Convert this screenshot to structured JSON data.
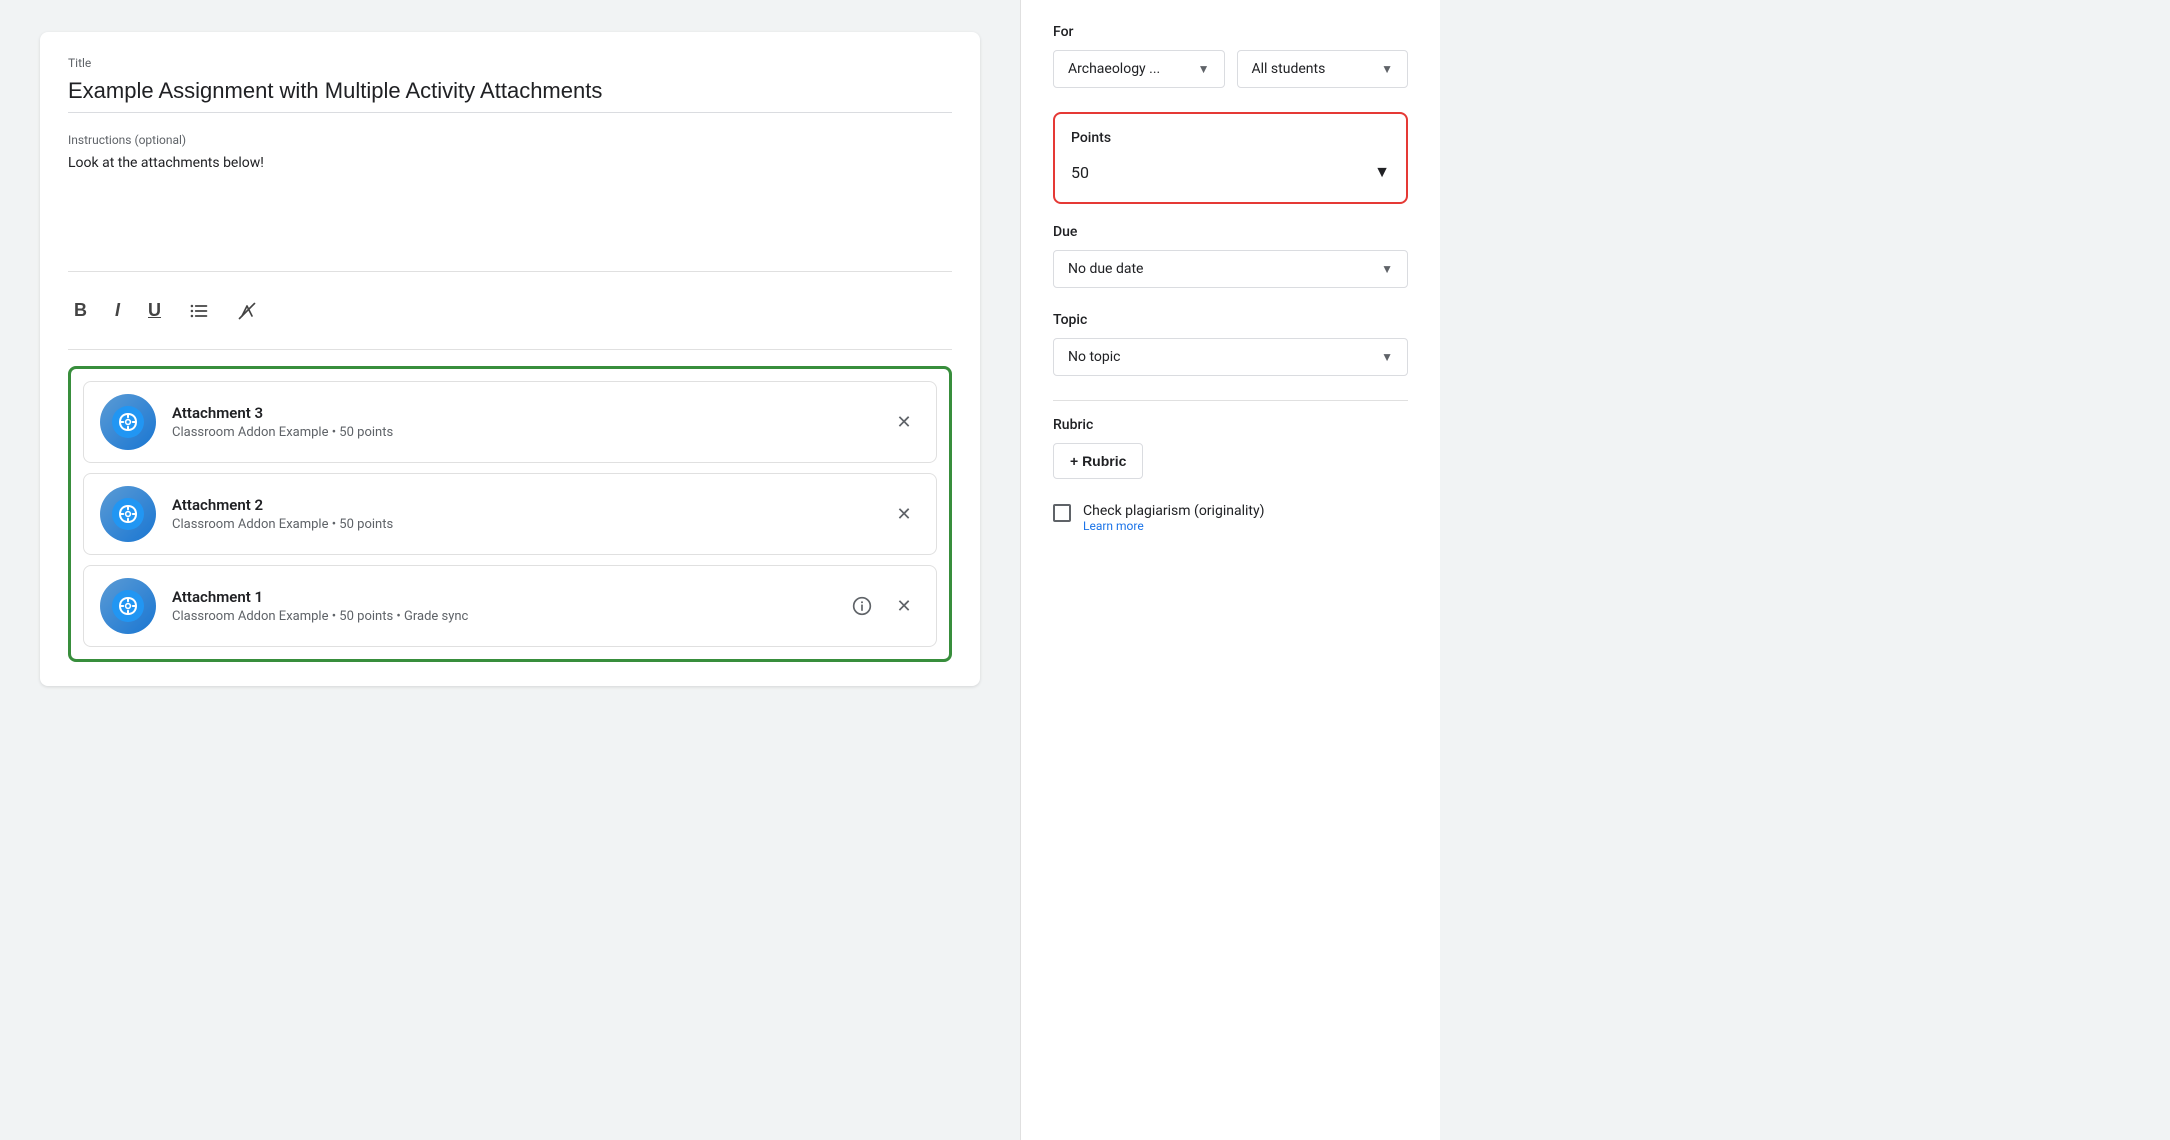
{
  "title_field": {
    "label": "Title",
    "value": "Example Assignment with Multiple Activity Attachments"
  },
  "instructions_field": {
    "label": "Instructions (optional)",
    "value": "Look at the attachments below!"
  },
  "toolbar": {
    "bold": "B",
    "italic": "I",
    "underline": "U"
  },
  "attachments": [
    {
      "name": "Attachment 3",
      "meta": "Classroom Addon Example • 50 points",
      "has_info": false
    },
    {
      "name": "Attachment 2",
      "meta": "Classroom Addon Example • 50 points",
      "has_info": false
    },
    {
      "name": "Attachment 1",
      "meta": "Classroom Addon Example • 50 points • Grade sync",
      "has_info": true
    }
  ],
  "sidebar": {
    "for_label": "For",
    "class_dropdown": "Archaeology ...",
    "students_dropdown": "All students",
    "points_label": "Points",
    "points_value": "50",
    "due_label": "Due",
    "due_value": "No due date",
    "topic_label": "Topic",
    "topic_value": "No topic",
    "rubric_label": "Rubric",
    "rubric_btn_label": "+ Rubric",
    "plagiarism_label": "Check plagiarism (originality)",
    "learn_more": "Learn more"
  }
}
